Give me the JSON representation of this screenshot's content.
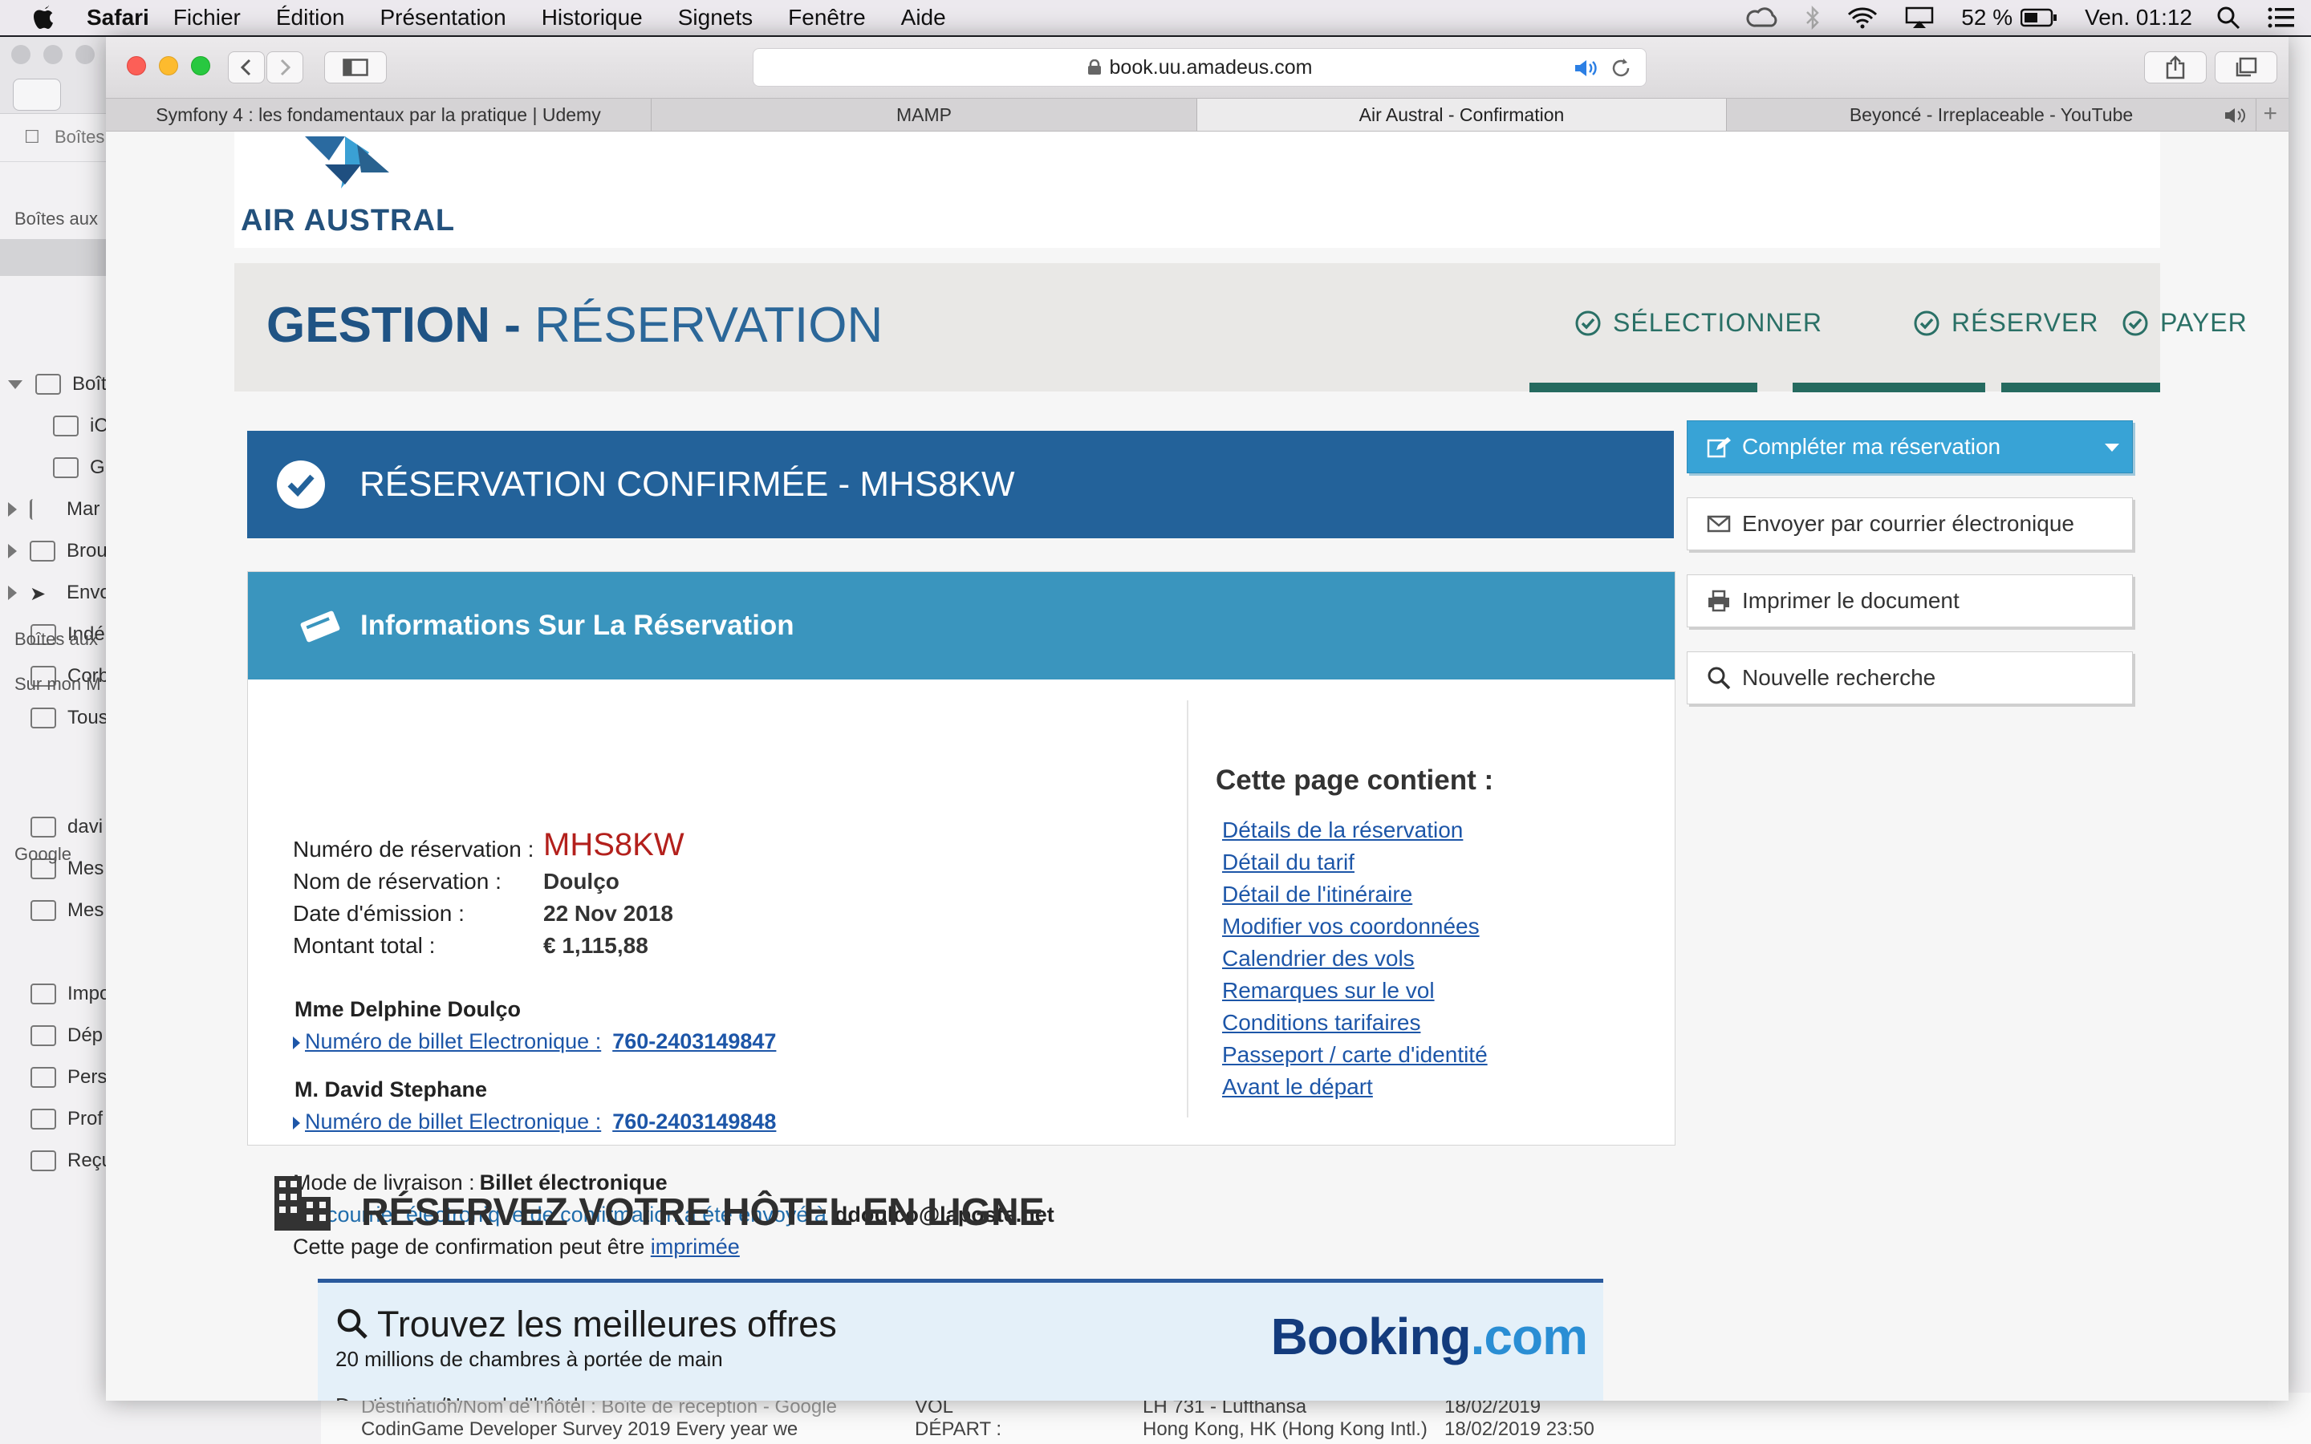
{
  "menubar": {
    "items": [
      "Safari",
      "Fichier",
      "Édition",
      "Présentation",
      "Historique",
      "Signets",
      "Fenêtre",
      "Aide"
    ],
    "battery": "52 %",
    "clock": "Ven. 01:12"
  },
  "mail_bg": {
    "toolbar_label": "Boîtes",
    "section1": "Boîtes aux",
    "items": [
      "Boît",
      "iC",
      "G",
      "Mar",
      "Brou",
      "Envo",
      "Indé",
      "Corb",
      "Tous"
    ],
    "section2": "Boîtes aux",
    "section3": "Sur mon M",
    "items2": [
      "davi",
      "Mes",
      "Mes"
    ],
    "section4": "Google",
    "items3": [
      "Impo",
      "Dép",
      "Pers",
      "Prof",
      "Reçu"
    ],
    "lower": {
      "line1": "Destination/Nom de l'hôtel :  Boîte de réception - Google",
      "line2": "CodinGame Developer Survey 2019 Every year we",
      "vol_label": "VOL",
      "vol_value": "LH 731 - Lufthansa",
      "vol_date": "18/02/2019",
      "dep_label": "DÉPART :",
      "dep_value": "Hong Kong, HK (Hong Kong Intl.)",
      "dep_date": "18/02/2019 23:50"
    }
  },
  "browser": {
    "url": "book.uu.amadeus.com",
    "tabs": [
      {
        "label": "Symfony 4 : les fondamentaux par la pratique | Udemy"
      },
      {
        "label": "MAMP"
      },
      {
        "label": "Air Austral - Confirmation"
      },
      {
        "label": "Beyoncé - Irreplaceable - YouTube"
      }
    ]
  },
  "page": {
    "logo_text": "AIR AUSTRAL",
    "header": {
      "title_bold": "GESTION -",
      "title_rest": "RÉSERVATION",
      "steps": [
        "SÉLECTIONNER",
        "RÉSERVER",
        "PAYER"
      ]
    },
    "confirm_title": "RÉSERVATION CONFIRMÉE - MHS8KW",
    "info_title": "Informations Sur La Réservation",
    "fields": {
      "num_label": "Numéro de réservation :",
      "num_value": "MHS8KW",
      "name_label": "Nom de réservation :",
      "name_value": "Doulço",
      "date_label": "Date d'émission :",
      "date_value": "22 Nov 2018",
      "total_label": "Montant total :",
      "total_value": "€ 1,115,88"
    },
    "passengers": [
      {
        "name": "Mme Delphine Doulço",
        "ticket_label": "Numéro de billet Electronique :",
        "ticket": "760-2403149847"
      },
      {
        "name": "M. David Stephane",
        "ticket_label": "Numéro de billet Electronique :",
        "ticket": "760-2403149848"
      }
    ],
    "delivery": {
      "label": "Mode de livraison :",
      "value": "Billet électronique",
      "email_text": "Un courrier électronique de confirmation a été envoyé à",
      "email": "ddoulco@laposte.net",
      "print_text": "Cette page de confirmation peut être",
      "print_link": "imprimée"
    },
    "contains_title": "Cette page contient :",
    "contains_links": [
      "Détails de la réservation",
      "Détail du tarif",
      "Détail de l'itinéraire",
      "Modifier vos coordonnées",
      "Calendrier des vols",
      "Remarques sur le vol",
      "Conditions tarifaires",
      "Passeport / carte d'identité",
      "Avant le départ"
    ],
    "side_buttons": [
      "Compléter ma réservation",
      "Envoyer par courrier électronique",
      "Imprimer le document",
      "Nouvelle recherche"
    ],
    "hotel_title": "RÉSERVEZ VOTRE HÔTEL EN LIGNE",
    "booking": {
      "title": "Trouvez les meilleures offres",
      "subtitle": "20 millions de chambres à portée de main",
      "dest_label": "Destination/Nom de l'hôtel :",
      "brand_a": "Booking",
      "brand_b": ".com"
    }
  },
  "colors": {
    "confirm_bar": "#23629a",
    "info_bar": "#3a95be",
    "step_green": "#256a5f",
    "primary_button": "#38a3d6",
    "reservation_red": "#b3201c"
  }
}
